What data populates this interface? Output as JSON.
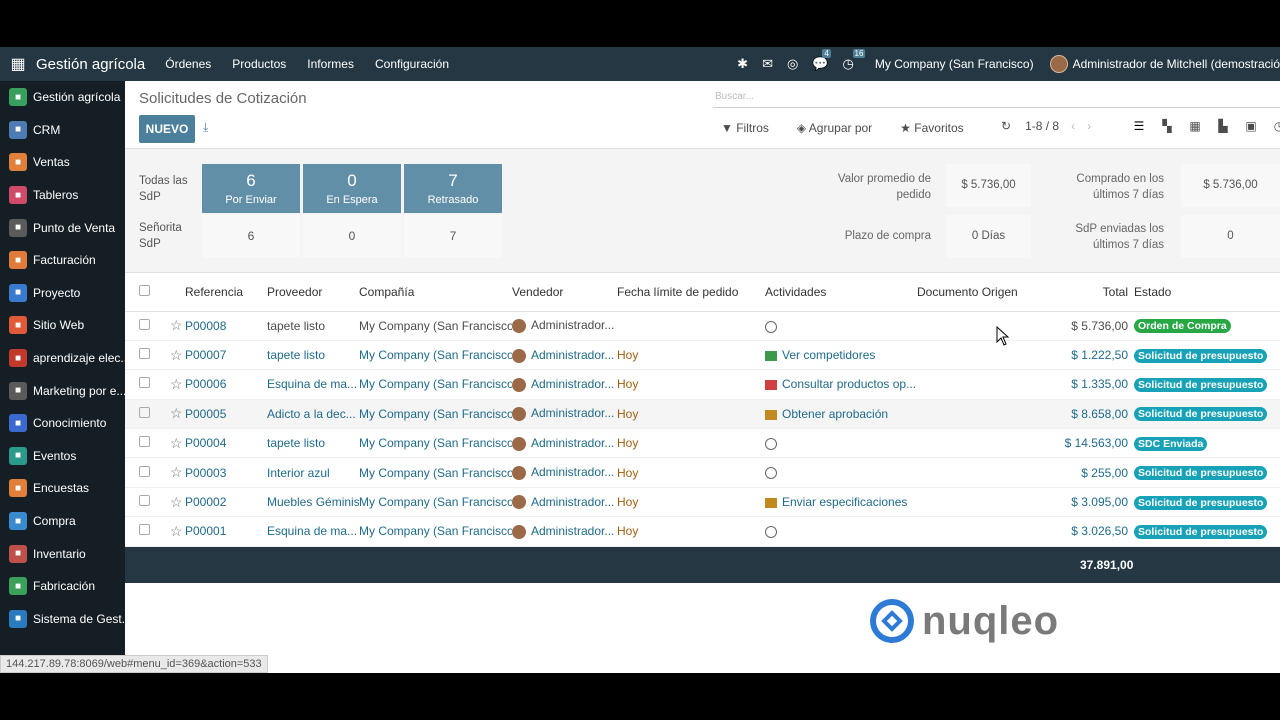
{
  "navbar": {
    "app_title": "Gestión agrícola",
    "menus": [
      "Órdenes",
      "Productos",
      "Informes",
      "Configuración"
    ],
    "chat_count": "4",
    "activity_count": "16",
    "company": "My Company (San Francisco)",
    "user": "Administrador de Mitchell (demostració"
  },
  "sidebar": {
    "items": [
      {
        "label": "Gestión agrícola",
        "color": "#38a05c"
      },
      {
        "label": "CRM",
        "color": "#4f7bb5"
      },
      {
        "label": "Ventas",
        "color": "#e0803a"
      },
      {
        "label": "Tableros",
        "color": "#d04a6a"
      },
      {
        "label": "Punto de Venta",
        "color": "#5a5a5a"
      },
      {
        "label": "Facturación",
        "color": "#e07b3a"
      },
      {
        "label": "Proyecto",
        "color": "#3a7bd0"
      },
      {
        "label": "Sitio Web",
        "color": "#e05a3a"
      },
      {
        "label": "aprendizaje elec...",
        "color": "#c0392b"
      },
      {
        "label": "Marketing por e...",
        "color": "#5a5a5a"
      },
      {
        "label": "Conocimiento",
        "color": "#3a6ad0"
      },
      {
        "label": "Eventos",
        "color": "#2a9a8a"
      },
      {
        "label": "Encuestas",
        "color": "#e0803a"
      },
      {
        "label": "Compra",
        "color": "#3a8ad0"
      },
      {
        "label": "Inventario",
        "color": "#c0504a"
      },
      {
        "label": "Fabricación",
        "color": "#3aa05a"
      },
      {
        "label": "Sistema de Gest...",
        "color": "#2a7ac0"
      }
    ]
  },
  "control_panel": {
    "breadcrumb": "Solicitudes de Cotización",
    "search_placeholder": "Buscar...",
    "new_button": "NUEVO",
    "filters": "Filtros",
    "group_by": "Agrupar por",
    "favorites": "Favoritos",
    "pager": "1-8 / 8"
  },
  "dashboard": {
    "all_label": "Todas las SdP",
    "my_label": "Señorita SdP",
    "tiles": [
      {
        "count": "6",
        "label": "Por Enviar",
        "mine": "6"
      },
      {
        "count": "0",
        "label": "En Espera",
        "mine": "0"
      },
      {
        "count": "7",
        "label": "Retrasado",
        "mine": "7"
      }
    ],
    "kpis": {
      "avg_label": "Valor promedio de pedido",
      "avg_value": "$ 5.736,00",
      "lead_label": "Plazo de compra",
      "lead_value": "0 Días",
      "bought_label": "Comprado en los últimos 7 días",
      "bought_value": "$ 5.736,00",
      "sent_label": "SdP enviadas los últimos 7 días",
      "sent_value": "0"
    }
  },
  "table": {
    "headers": [
      "Referencia",
      "Proveedor",
      "Compañía",
      "Vendedor",
      "Fecha límite de pedido",
      "Actividades",
      "Documento Origen",
      "Total",
      "Estado"
    ],
    "rows": [
      {
        "ref": "P00008",
        "vendor": "tapete listo",
        "company": "My Company (San Francisco)",
        "rep": "Administrador...",
        "deadline": "",
        "activity": "",
        "act_type": "clock",
        "total": "$ 5.736,00",
        "status": "Orden de Compra",
        "status_color": "green",
        "dim": true
      },
      {
        "ref": "P00007",
        "vendor": "tapete listo",
        "company": "My Company (San Francisco)",
        "rep": "Administrador...",
        "deadline": "Hoy",
        "activity": "Ver competidores",
        "act_type": "green",
        "total": "$ 1.222,50",
        "status": "Solicitud de presupuesto",
        "status_color": "blue",
        "dim": false
      },
      {
        "ref": "P00006",
        "vendor": "Esquina de ma...",
        "company": "My Company (San Francisco)",
        "rep": "Administrador...",
        "deadline": "Hoy",
        "activity": "Consultar productos op...",
        "act_type": "red",
        "total": "$ 1.335,00",
        "status": "Solicitud de presupuesto",
        "status_color": "blue",
        "dim": false
      },
      {
        "ref": "P00005",
        "vendor": "Adicto a la dec...",
        "company": "My Company (San Francisco)",
        "rep": "Administrador...",
        "deadline": "Hoy",
        "activity": "Obtener aprobación",
        "act_type": "orange",
        "total": "$ 8.658,00",
        "status": "Solicitud de presupuesto",
        "status_color": "blue",
        "dim": false
      },
      {
        "ref": "P00004",
        "vendor": "tapete listo",
        "company": "My Company (San Francisco)",
        "rep": "Administrador...",
        "deadline": "Hoy",
        "activity": "",
        "act_type": "clock",
        "total": "$ 14.563,00",
        "status": "SDC Enviada",
        "status_color": "blue",
        "dim": false
      },
      {
        "ref": "P00003",
        "vendor": "Interior azul",
        "company": "My Company (San Francisco)",
        "rep": "Administrador...",
        "deadline": "Hoy",
        "activity": "",
        "act_type": "clock",
        "total": "$ 255,00",
        "status": "Solicitud de presupuesto",
        "status_color": "blue",
        "dim": false
      },
      {
        "ref": "P00002",
        "vendor": "Muebles Géminis",
        "company": "My Company (San Francisco)",
        "rep": "Administrador...",
        "deadline": "Hoy",
        "activity": "Enviar especificaciones",
        "act_type": "mail",
        "total": "$ 3.095,00",
        "status": "Solicitud de presupuesto",
        "status_color": "blue",
        "dim": false
      },
      {
        "ref": "P00001",
        "vendor": "Esquina de ma...",
        "company": "My Company (San Francisco)",
        "rep": "Administrador...",
        "deadline": "Hoy",
        "activity": "",
        "act_type": "clock",
        "total": "$ 3.026,50",
        "status": "Solicitud de presupuesto",
        "status_color": "blue",
        "dim": false
      }
    ],
    "grand_total": "37.891,00"
  },
  "watermark": "nuqleo",
  "status_url": "144.217.89.78:8069/web#menu_id=369&action=533"
}
